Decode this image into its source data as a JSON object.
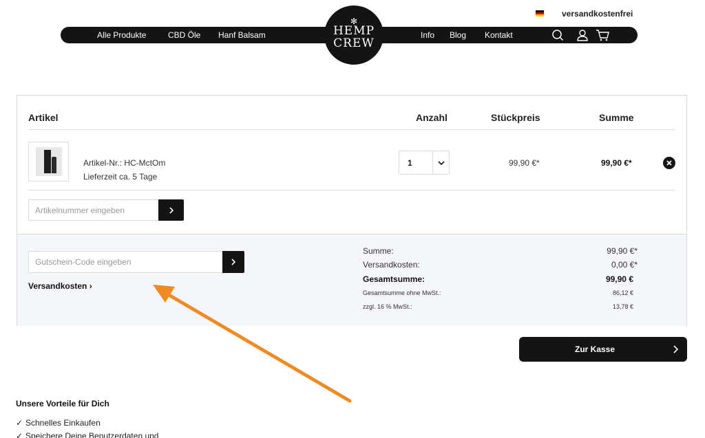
{
  "header": {
    "top_note": "versandkostenfrei",
    "nav_left": [
      "Alle Produkte",
      "CBD Öle",
      "Hanf Balsam"
    ],
    "nav_right": [
      "Info",
      "Blog",
      "Kontakt"
    ],
    "logo_line1": "HEMP",
    "logo_line2": "CREW",
    "icons": [
      "search-icon",
      "user-icon",
      "cart-icon"
    ],
    "flag_colors": [
      "#000000",
      "#dd0000",
      "#ffce00"
    ]
  },
  "cart": {
    "headers": {
      "article": "Artikel",
      "quantity": "Anzahl",
      "unit_price": "Stückpreis",
      "total": "Summe"
    },
    "item": {
      "sku": "Artikel-Nr.: HC-MctOm",
      "delivery": "Lieferzeit ca. 5 Tage",
      "quantity": "1",
      "unit_price": "99,90 €*",
      "total": "99,90 €*"
    },
    "sku_input_placeholder": "Artikelnummer eingeben",
    "voucher_input_placeholder": "Gutschein-Code eingeben",
    "shipping_link": "Versandkosten",
    "summary": {
      "subtotal_label": "Summe:",
      "subtotal_value": "99,90 €*",
      "shipping_label": "Versandkosten:",
      "shipping_value": "0,00 €*",
      "grand_label": "Gesamtsumme:",
      "grand_value": "99,90 €",
      "net_label": "Gesamtsumme ohne MwSt.:",
      "net_value": "86,12 €",
      "vat_label": "zzgl. 16 % MwSt.:",
      "vat_value": "13,78 €"
    },
    "checkout_label": "Zur Kasse"
  },
  "advantages": {
    "title": "Unsere Vorteile für Dich",
    "items": [
      "Schnelles Einkaufen",
      "Speichere Deine Benutzerdaten und"
    ]
  },
  "accent_color": "#f08a24"
}
